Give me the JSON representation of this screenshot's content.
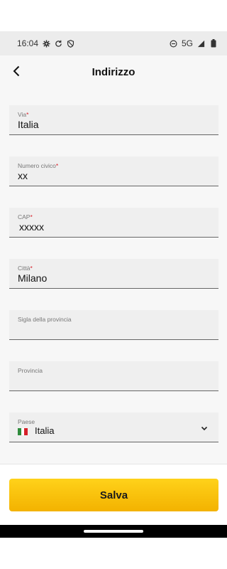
{
  "status": {
    "time": "16:04",
    "network": "5G"
  },
  "header": {
    "title": "Indirizzo"
  },
  "form": {
    "via": {
      "label": "Via",
      "required_mark": "*",
      "value": "Italia"
    },
    "numero": {
      "label": "Numero civico",
      "required_mark": "*",
      "value": "xx"
    },
    "cap": {
      "label": "CAP",
      "required_mark": "*",
      "value": "xxxxx"
    },
    "citta": {
      "label": "Città",
      "required_mark": "*",
      "value": "Milano"
    },
    "sigla": {
      "label": "Sigla della provincia",
      "value": ""
    },
    "provincia": {
      "label": "Provincia",
      "value": ""
    },
    "paese": {
      "label": "Paese",
      "value": "Italia",
      "flag": [
        "#2e8b3c",
        "#ffffff",
        "#d6202a"
      ]
    }
  },
  "actions": {
    "save_label": "Salva"
  },
  "colors": {
    "accent": "#f8c80c",
    "required": "#d6202a"
  }
}
